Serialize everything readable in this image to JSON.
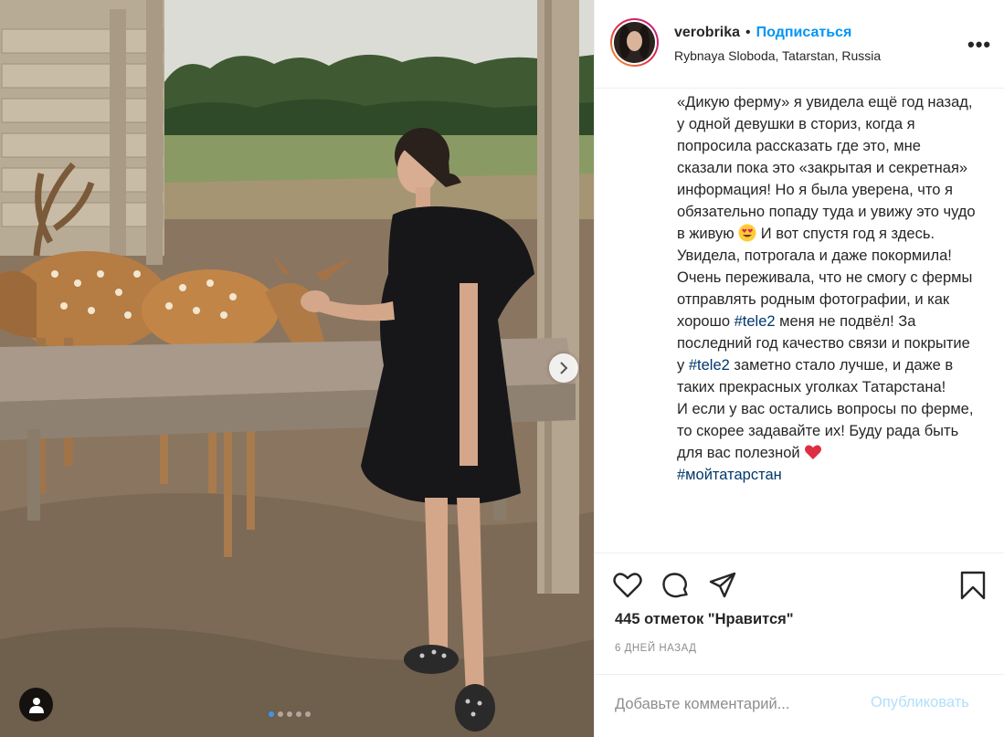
{
  "header": {
    "username": "verobrika",
    "separator": "•",
    "follow_label": "Подписаться",
    "location": "Rybnaya Sloboda, Tatarstan, Russia",
    "more_label": "•••"
  },
  "caption": {
    "part1": "«Дикую ферму» я увидела ещё год назад, у одной девушки в сториз, когда я попросила рассказать где это, мне сказали пока это «закрытая и секретная» информация! Но я была уверена, что я обязательно попаду туда и увижу это чудо в живую ",
    "emoji1": "heart-eyes-emoji",
    "part2": " И вот спустя год я здесь. Увидела, потрогала и даже покормила! Очень переживала, что не смогу с фермы отправлять родным фотографии, и как хорошо ",
    "hashtag1": "#tele2",
    "part3": " меня не подвёл! За последний год качество связи и покрытие у ",
    "hashtag2": "#tele2",
    "part4": " заметно стало лучше, и даже в таких прекрасных уголках Татарстана!",
    "part5": "И если у вас остались вопросы по ферме, то скорее задавайте их! Буду рада быть для вас полезной ",
    "emoji2": "red-heart-emoji",
    "hashtag3": "#мойтатарстан"
  },
  "actions": {
    "icons": [
      "heart-icon",
      "comment-icon",
      "share-icon",
      "bookmark-icon"
    ],
    "likes_text": "445 отметок \"Нравится\"",
    "timestamp": "6 дней назад"
  },
  "comment": {
    "placeholder": "Добавьте комментарий...",
    "post_label": "Опубликовать"
  },
  "carousel": {
    "slide_count": 5,
    "active_slide": 1
  },
  "colors": {
    "accent": "#0095f6",
    "hashtag": "#00376b",
    "muted": "#8e8e8e",
    "post_disabled": "#b2dffc"
  }
}
